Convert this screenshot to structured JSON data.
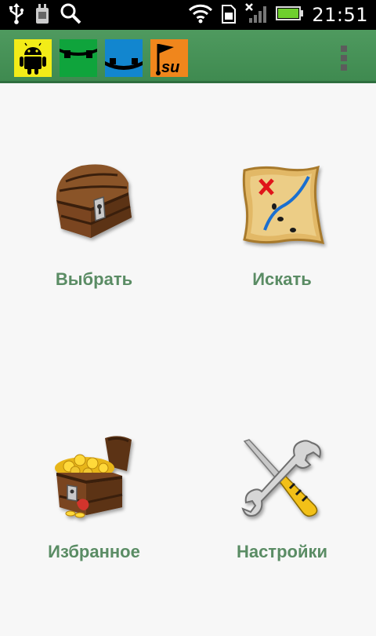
{
  "status_bar": {
    "time": "21:51",
    "left_icons": [
      "usb-icon",
      "sd-card-icon",
      "search-icon"
    ],
    "right_icons": [
      "wifi-icon",
      "sim-card-icon",
      "no-signal-icon",
      "battery-icon"
    ]
  },
  "action_bar": {
    "apps": [
      {
        "name": "android-app-icon",
        "bg": "#f2ec18"
      },
      {
        "name": "green-app-icon",
        "bg": "#0fa43c"
      },
      {
        "name": "blue-app-icon",
        "bg": "#1286cf"
      },
      {
        "name": "orange-su-app-icon",
        "bg": "#f0861c",
        "text": "su"
      }
    ],
    "overflow_icon": "overflow-menu-icon"
  },
  "menu": {
    "items": [
      {
        "label": "Выбрать",
        "icon": "treasure-chest-icon"
      },
      {
        "label": "Искать",
        "icon": "treasure-map-icon"
      },
      {
        "label": "Избранное",
        "icon": "gold-chest-icon"
      },
      {
        "label": "Настройки",
        "icon": "wrench-screwdriver-icon"
      }
    ]
  },
  "colors": {
    "action_bar": "#4a955a",
    "label_green": "#5a8c64",
    "background": "#f7f7f7"
  }
}
